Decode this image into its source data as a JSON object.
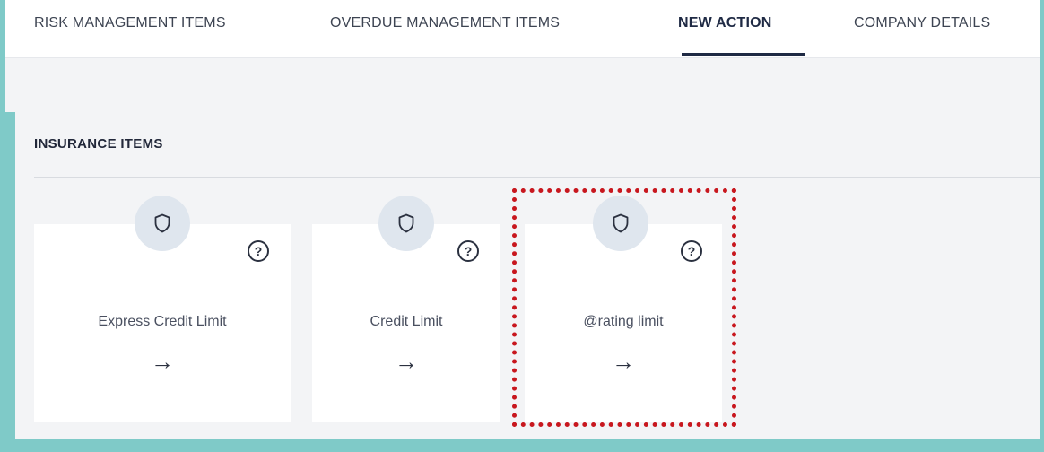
{
  "tabs": [
    {
      "label": "RISK MANAGEMENT ITEMS",
      "active": false
    },
    {
      "label": "OVERDUE MANAGEMENT ITEMS",
      "active": false
    },
    {
      "label": "NEW ACTION",
      "active": true
    },
    {
      "label": "COMPANY DETAILS",
      "active": false
    }
  ],
  "section": {
    "title": "INSURANCE ITEMS"
  },
  "cards": [
    {
      "label": "Express Credit Limit",
      "icon": "shield-icon",
      "help": "?",
      "arrow": "→"
    },
    {
      "label": "Credit Limit",
      "icon": "shield-icon",
      "help": "?",
      "arrow": "→"
    },
    {
      "label": "@rating limit",
      "icon": "shield-icon",
      "help": "?",
      "arrow": "→",
      "highlighted": true
    }
  ],
  "colors": {
    "frame": "#7fcac8",
    "panel": "#f3f4f6",
    "highlight": "#c8171e",
    "active_tab": "#1f2a44"
  }
}
